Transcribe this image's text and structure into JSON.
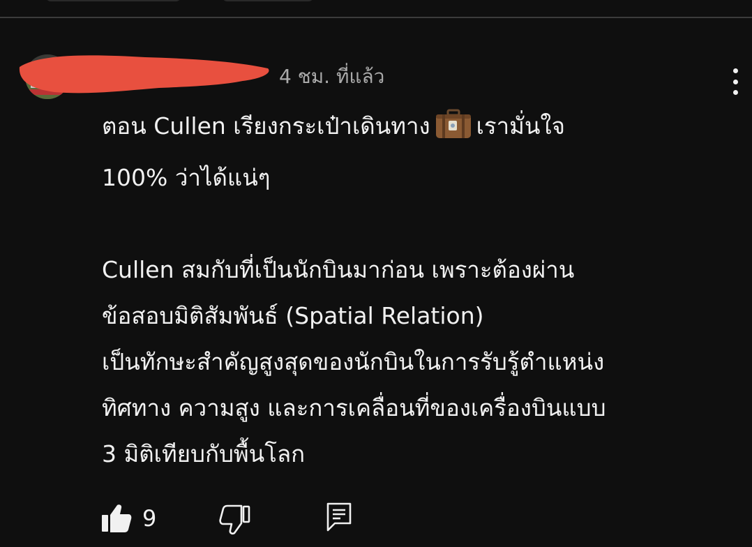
{
  "comment": {
    "author_name": "",
    "timestamp": "4 ชม. ที่แล้ว",
    "paragraphs": [
      {
        "lines": [
          {
            "before": "ตอน Cullen เรียงกระเป๋าเดินทาง",
            "emoji": "suitcase-icon",
            "after": "เรามั่นใจ"
          },
          {
            "before": "100% ว่าได้แน่ๆ"
          }
        ]
      },
      {
        "lines": [
          {
            "before": "Cullen สมกับที่เป็นนักบินมาก่อน เพราะต้องผ่าน"
          },
          {
            "before": "ข้อสอบมิติสัมพันธ์ (Spatial Relation)"
          },
          {
            "before": "เป็นทักษะสำคัญสูงสุดของนักบินในการรับรู้ตำแหน่ง"
          },
          {
            "before": "ทิศทาง ความสูง และการเคลื่อนที่ของเครื่องบินแบบ"
          },
          {
            "before": "3 มิติเทียบกับพื้นโลก"
          }
        ]
      }
    ],
    "like_count": "9",
    "redaction_color": "#e8503f"
  }
}
